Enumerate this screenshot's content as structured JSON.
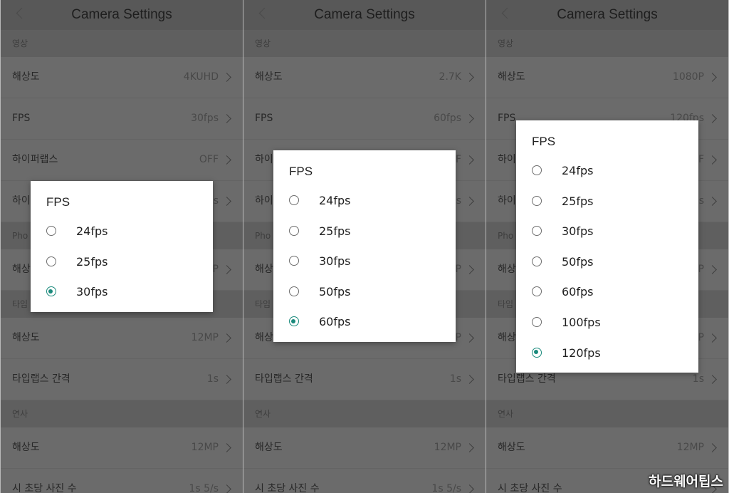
{
  "panels": [
    {
      "title": "Camera Settings",
      "sections": [
        {
          "label": "영상",
          "rows": [
            {
              "label": "해상도",
              "value": "4KUHD"
            },
            {
              "label": "FPS",
              "value": "30fps"
            },
            {
              "label": "하이퍼랩스",
              "value": "OFF"
            },
            {
              "label": "하이",
              "value": "s"
            }
          ]
        },
        {
          "label": "Pho",
          "rows": [
            {
              "label": "해상",
              "value": "P"
            }
          ]
        },
        {
          "label": "타임",
          "rows": [
            {
              "label": "해상도",
              "value": "12MP"
            },
            {
              "label": "타입랩스 간격",
              "value": "1s"
            }
          ]
        },
        {
          "label": "연사",
          "rows": [
            {
              "label": "해상도",
              "value": "12MP"
            },
            {
              "label": "시 초당 사진 수",
              "value": "1s 5/s"
            }
          ]
        }
      ],
      "dialog": {
        "title": "FPS",
        "options": [
          "24fps",
          "25fps",
          "30fps"
        ],
        "selected": "30fps"
      }
    },
    {
      "title": "Camera Settings",
      "sections": [
        {
          "label": "영상",
          "rows": [
            {
              "label": "해상도",
              "value": "2.7K"
            },
            {
              "label": "FPS",
              "value": "60fps"
            },
            {
              "label": "하이",
              "value": "F"
            },
            {
              "label": "하이",
              "value": "s"
            }
          ]
        },
        {
          "label": "Pho",
          "rows": [
            {
              "label": "해상",
              "value": "P"
            }
          ]
        },
        {
          "label": "타임",
          "rows": [
            {
              "label": "해상",
              "value": "P"
            },
            {
              "label": "타입랩스 간격",
              "value": "1s"
            }
          ]
        },
        {
          "label": "연사",
          "rows": [
            {
              "label": "해상도",
              "value": "12MP"
            },
            {
              "label": "시 초당 사진 수",
              "value": "1s 5/s"
            }
          ]
        }
      ],
      "dialog": {
        "title": "FPS",
        "options": [
          "24fps",
          "25fps",
          "30fps",
          "50fps",
          "60fps"
        ],
        "selected": "60fps"
      }
    },
    {
      "title": "Camera Settings",
      "sections": [
        {
          "label": "영상",
          "rows": [
            {
              "label": "해상도",
              "value": "1080P"
            },
            {
              "label": "FPS",
              "value": "120fps"
            },
            {
              "label": "하이",
              "value": "F"
            },
            {
              "label": "하이",
              "value": "s"
            }
          ]
        },
        {
          "label": "Pho",
          "rows": [
            {
              "label": "해상",
              "value": "P"
            }
          ]
        },
        {
          "label": "타임",
          "rows": [
            {
              "label": "해상",
              "value": "P"
            },
            {
              "label": "타입랩스 간격",
              "value": "1s"
            }
          ]
        },
        {
          "label": "연사",
          "rows": [
            {
              "label": "해상도",
              "value": "12MP"
            },
            {
              "label": "시 초당 사진 수",
              "value": ""
            }
          ]
        }
      ],
      "dialog": {
        "title": "FPS",
        "options": [
          "24fps",
          "25fps",
          "30fps",
          "50fps",
          "60fps",
          "100fps",
          "120fps"
        ],
        "selected": "120fps"
      }
    }
  ],
  "watermark": "하드웨어팁스",
  "colors": {
    "accent": "#1a8a7c",
    "dim_background": "#6b6b6b",
    "dialog_background": "#ffffff"
  }
}
